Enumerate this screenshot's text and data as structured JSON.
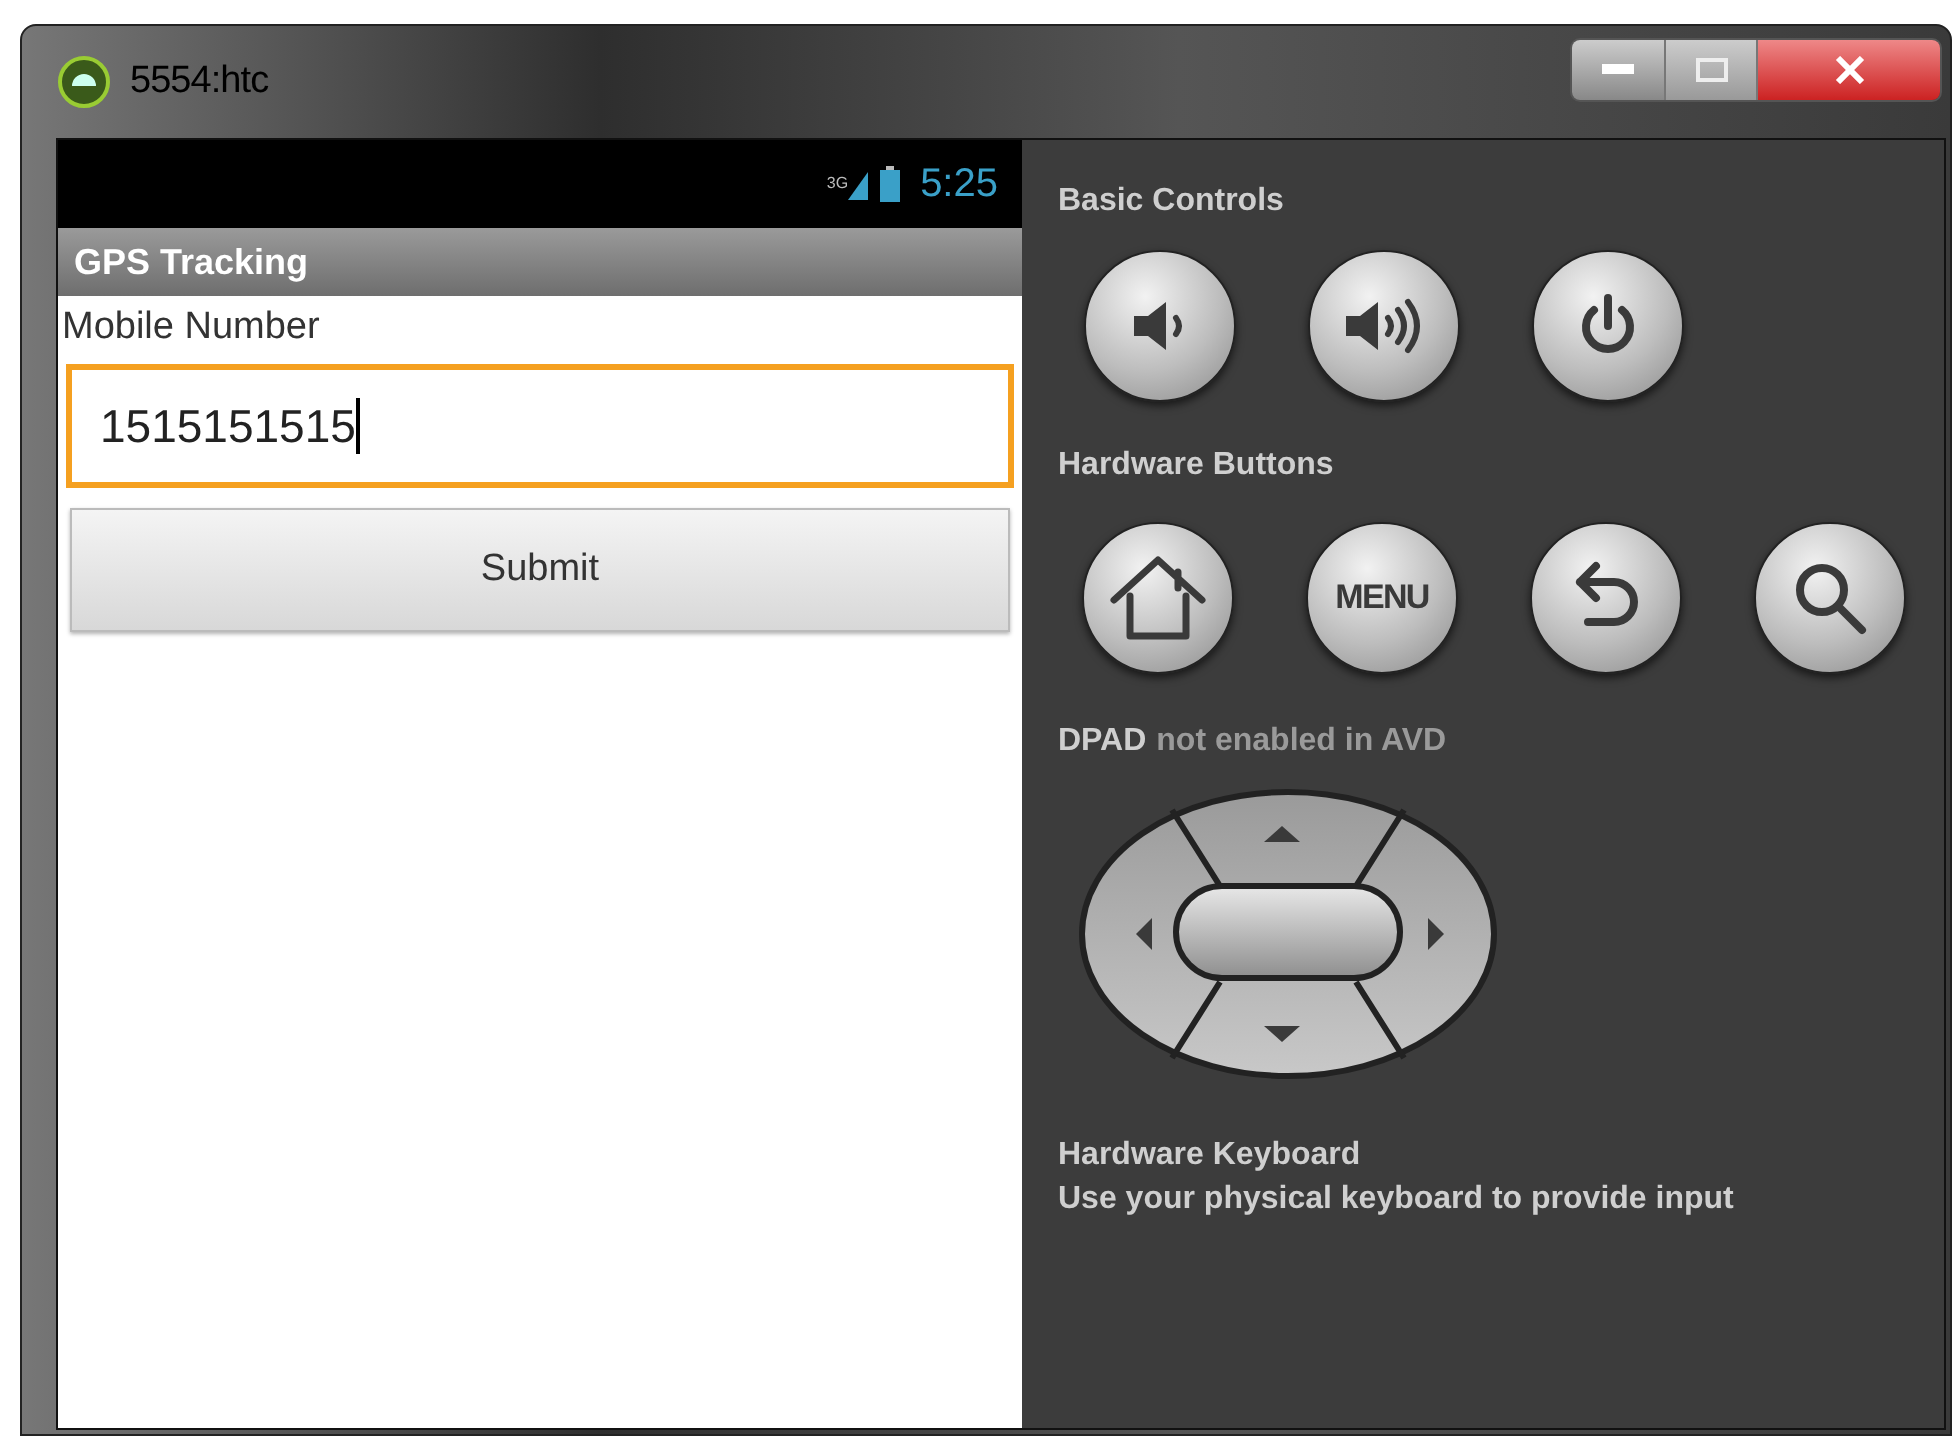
{
  "window": {
    "title": "5554:htc"
  },
  "phone": {
    "status_bar": {
      "network": "3G",
      "time": "5:25"
    },
    "app_bar": {
      "title": "GPS Tracking"
    },
    "form": {
      "label": "Mobile Number",
      "field": {
        "value": "1515151515",
        "focused": true
      },
      "submit": "Submit"
    }
  },
  "controls": {
    "basic": {
      "title": "Basic Controls",
      "buttons": [
        {
          "kind": "volume-down"
        },
        {
          "kind": "volume-up"
        },
        {
          "kind": "power"
        }
      ]
    },
    "hardware": {
      "title": "Hardware Buttons",
      "buttons": [
        {
          "kind": "home"
        },
        {
          "kind": "menu",
          "label": "MENU"
        },
        {
          "kind": "back"
        },
        {
          "kind": "search"
        }
      ]
    },
    "dpad": {
      "name": "DPAD",
      "note": "not enabled in AVD"
    },
    "keyboard": {
      "title": "Hardware Keyboard",
      "description": "Use your physical keyboard to provide input"
    }
  }
}
